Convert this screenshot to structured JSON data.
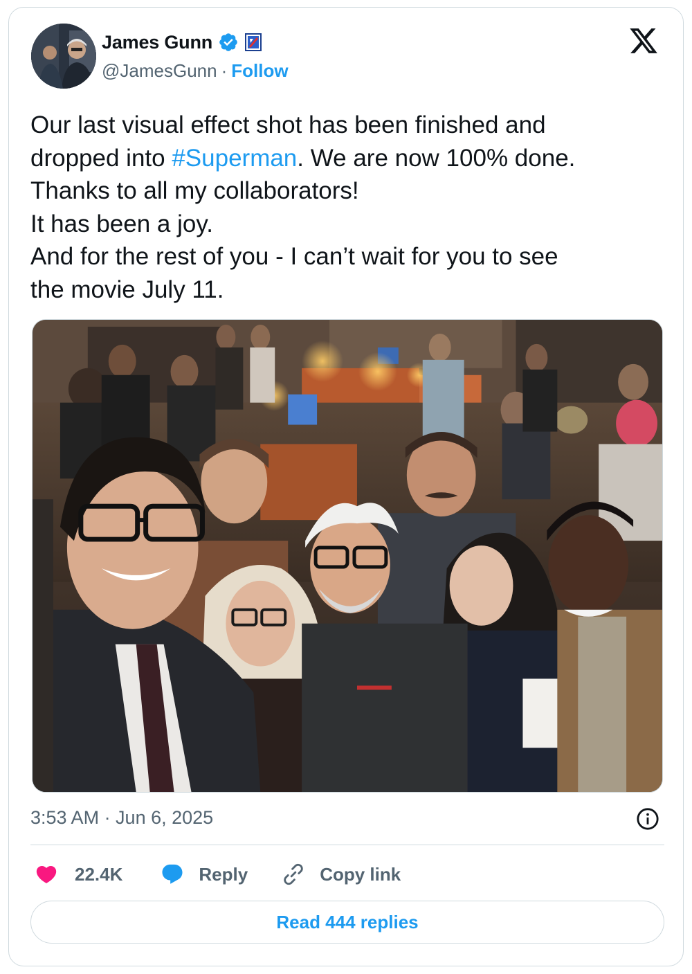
{
  "author": {
    "display_name": "James Gunn",
    "handle": "@JamesGunn",
    "separator": "·",
    "follow_label": "Follow",
    "verified": true,
    "verified_icon": "verified-badge-icon",
    "affiliate_icon": "affiliate-badge-icon",
    "avatar": "profile-photo"
  },
  "platform_icon": "x-logo-icon",
  "tweet": {
    "lines": [
      {
        "before": "Our last visual effect shot has been finished and",
        "hashtag": "",
        "after": ""
      },
      {
        "before": "dropped into ",
        "hashtag": "#Superman",
        "after": ". We are now 100% done."
      },
      {
        "before": "Thanks to all my collaborators!",
        "hashtag": "",
        "after": ""
      },
      {
        "before": "It has been a joy.",
        "hashtag": "",
        "after": ""
      },
      {
        "before": "And for the rest of you - I can’t wait for you to see",
        "hashtag": "",
        "after": ""
      },
      {
        "before": "the movie July 11.",
        "hashtag": "",
        "after": ""
      }
    ],
    "media": "group-selfie-photo"
  },
  "meta": {
    "timestamp": "3:53 AM · Jun 6, 2025",
    "info_icon": "info-icon"
  },
  "actions": {
    "like_count": "22.4K",
    "reply_label": "Reply",
    "copy_link_label": "Copy link"
  },
  "read_replies_label": "Read 444 replies",
  "colors": {
    "accent": "#1d9bf0",
    "like": "#f91880",
    "text": "#0f1419",
    "secondary": "#536471",
    "border": "#cfd9de"
  }
}
